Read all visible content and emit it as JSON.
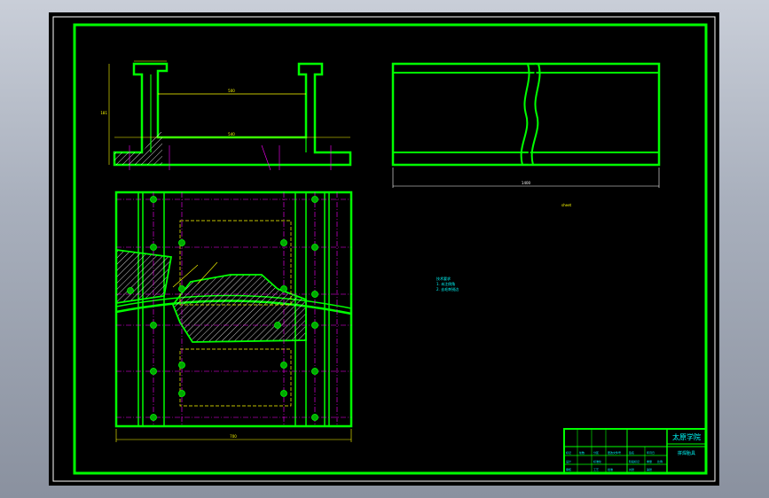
{
  "colors": {
    "background": "#000000",
    "frame": "#ffffff",
    "outline": "#00ff00",
    "dimension": "#ffff00",
    "centerline": "#ff00ff",
    "hatch": "#ffffff",
    "hole": "#00aa00",
    "annotation": "#00ffff"
  },
  "title_block": {
    "school": "太原学院",
    "drawing_name": "拼焊胎具",
    "cells": [
      "标记",
      "处数",
      "分区",
      "更改文件号",
      "签名",
      "年月日",
      "设计",
      "标准化",
      "阶段标记",
      "重量",
      "比例",
      "审核",
      "工艺",
      "批准",
      "共张",
      "第张"
    ]
  },
  "notes": {
    "note_right": "sheet",
    "tech_lines": [
      "技术要求",
      "1. 未注倒角",
      "2. 去毛刺锐边"
    ]
  },
  "dimensions": {
    "front_top": "500",
    "front_mid": "540",
    "front_height": "181",
    "plan_width": "700",
    "side_bottom": "1400"
  }
}
